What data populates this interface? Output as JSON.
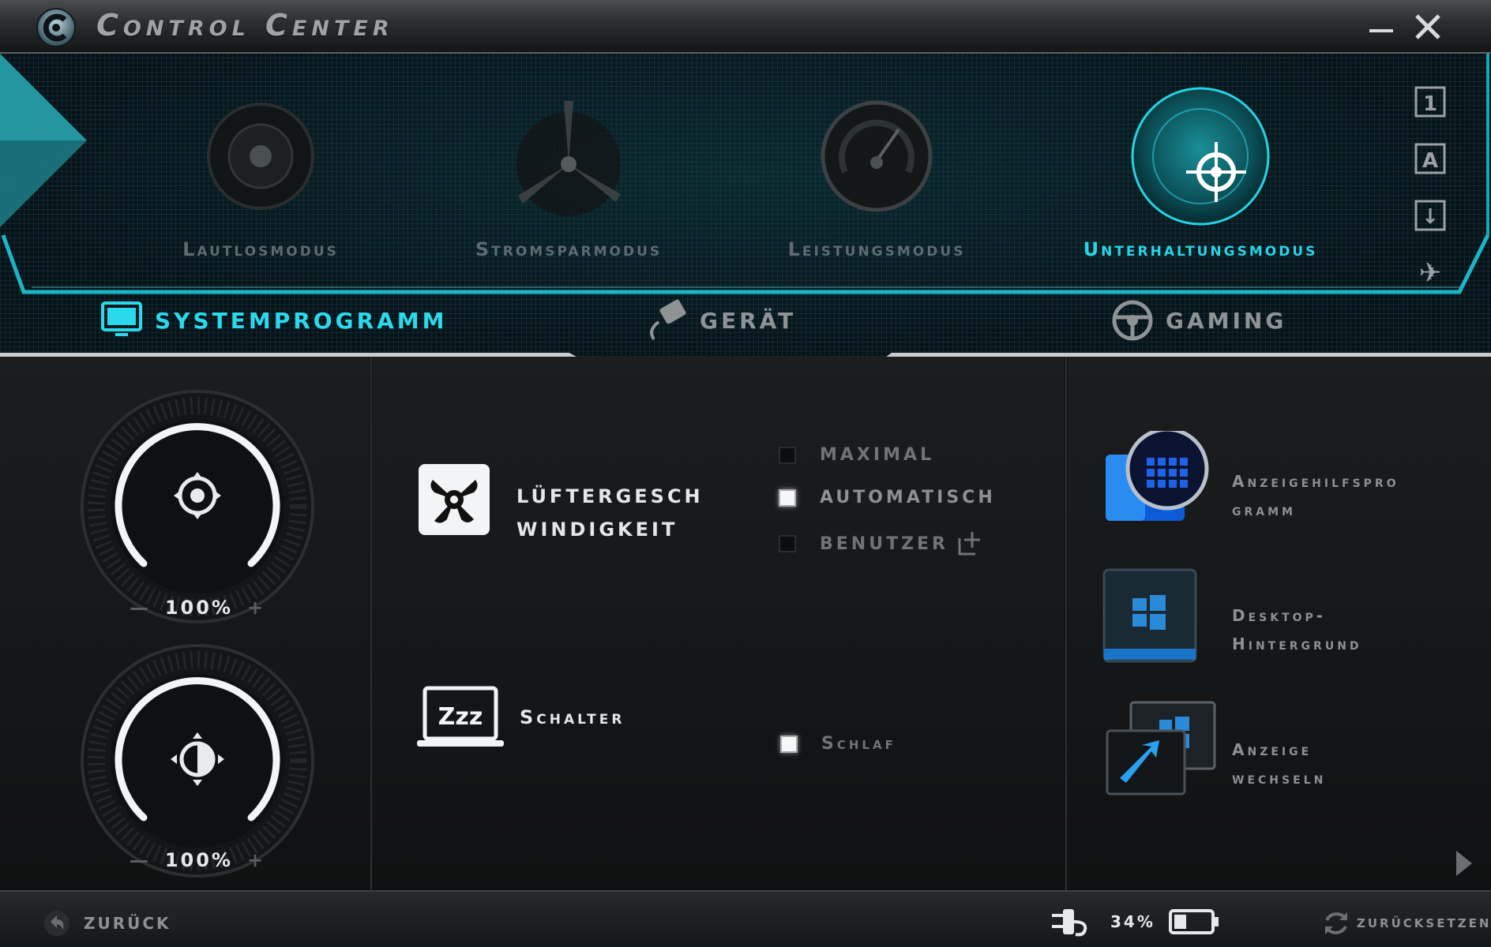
{
  "window": {
    "title": "Control Center",
    "minimize_glyph": "—",
    "close_glyph": "X"
  },
  "modes": [
    {
      "label": "Lautlosmodus",
      "icon": "speaker-icon",
      "active": false
    },
    {
      "label": "Stromsparmodus",
      "icon": "wind-turbine-icon",
      "active": false
    },
    {
      "label": "Leistungsmodus",
      "icon": "speedometer-icon",
      "active": false
    },
    {
      "label": "Unterhaltungsmodus",
      "icon": "crosshair-radar-icon",
      "active": true
    }
  ],
  "side_icons": [
    {
      "name": "profile-1-icon",
      "glyph": "1"
    },
    {
      "name": "font-a-icon",
      "glyph": "A"
    },
    {
      "name": "download-icon",
      "glyph": "↓"
    },
    {
      "name": "airplane-mode-icon",
      "glyph": "✈"
    }
  ],
  "tabs": [
    {
      "label": "SYSTEMPROGRAMM",
      "icon": "monitor-icon",
      "active": true
    },
    {
      "label": "GERÄT",
      "icon": "plug-icon",
      "active": false
    },
    {
      "label": "GAMING",
      "icon": "steering-wheel-icon",
      "active": false
    }
  ],
  "dials": [
    {
      "icon": "volume-knob-icon",
      "value": "100%",
      "minus": "—",
      "plus": "+",
      "level": 1.0
    },
    {
      "icon": "brightness-icon",
      "value": "100%",
      "minus": "—",
      "plus": "+",
      "level": 1.0
    }
  ],
  "fan": {
    "title_line1": "LÜFTERGESCH",
    "title_line2": "WINDIGKEIT",
    "options": [
      {
        "label": "MAXIMAL",
        "checked": false
      },
      {
        "label": "AUTOMATISCH",
        "checked": true
      },
      {
        "label": "BENUTZER",
        "checked": false
      }
    ]
  },
  "switch": {
    "title": "Schalter",
    "icon_text": "Zzz",
    "options": [
      {
        "label": "Schlaf",
        "checked": true
      }
    ]
  },
  "apps": [
    {
      "line1": "Anzeigehilfspro",
      "line2": "gramm",
      "icon": "display-helper-icon"
    },
    {
      "line1": "Desktop-",
      "line2": "Hintergrund",
      "icon": "windows-desktop-icon"
    },
    {
      "line1": "Anzeige",
      "line2": "wechseln",
      "icon": "switch-display-icon"
    }
  ],
  "footer": {
    "back_label": "ZURÜCK",
    "battery_percent": "34%",
    "battery_level": 0.34,
    "reset_label": "ZURÜCKSETZEN"
  },
  "colors": {
    "accent": "#27d4e6",
    "inactive_text": "#5f6b6f",
    "background": "#0b0c0d"
  }
}
